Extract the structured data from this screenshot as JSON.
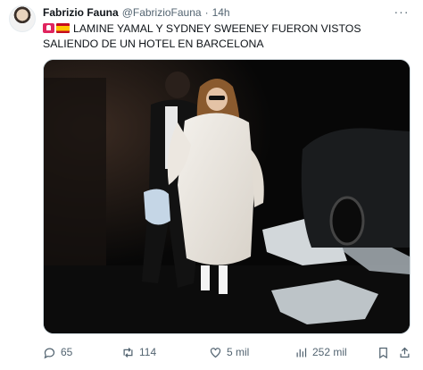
{
  "author": {
    "name": "Fabrizio Fauna",
    "handle": "@FabrizioFauna",
    "separator": "·",
    "time": "14h"
  },
  "tweet_text": "LAMINE YAMAL Y SYDNEY SWEENEY FUERON VISTOS SALIENDO DE UN HOTEL EN BARCELONA",
  "leading_icons": [
    "rotating-light-emoji",
    "spain-flag-emoji"
  ],
  "media": {
    "icon": "photo"
  },
  "actions": {
    "replies": "65",
    "retweets": "114",
    "likes": "5 mil",
    "views": "252 mil"
  },
  "colors": {
    "text": "#0f1419",
    "secondary": "#536471",
    "border": "#cfd9de"
  }
}
